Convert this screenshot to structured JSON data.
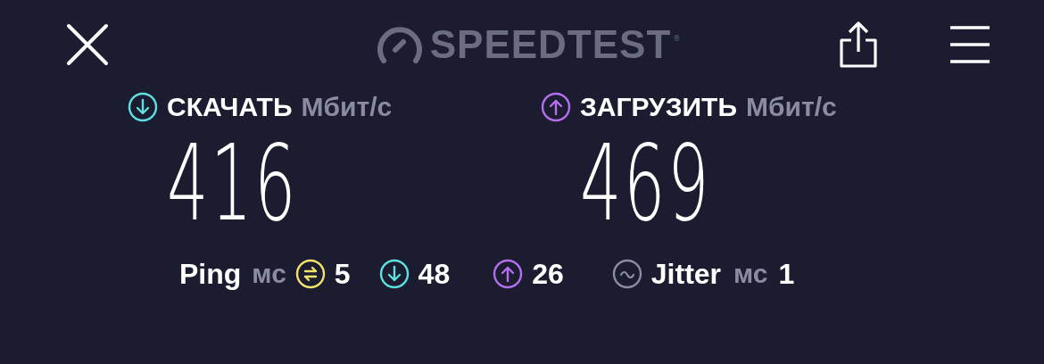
{
  "header": {
    "logo": "SPEEDTEST",
    "logo_mark": "®"
  },
  "results": [
    {
      "kind": "download",
      "label": "СКАЧАТЬ",
      "unit": "Мбит/с",
      "value": "416"
    },
    {
      "kind": "upload",
      "label": "ЗАГРУЗИТЬ",
      "unit": "Мбит/с",
      "value": "469"
    }
  ],
  "ping": {
    "label": "Ping",
    "unit": "мс",
    "stats": [
      {
        "kind": "ping",
        "value": "5"
      },
      {
        "kind": "download",
        "value": "48"
      },
      {
        "kind": "upload",
        "value": "26"
      }
    ]
  },
  "jitter": {
    "label": "Jitter",
    "unit": "мс",
    "value": "1"
  }
}
